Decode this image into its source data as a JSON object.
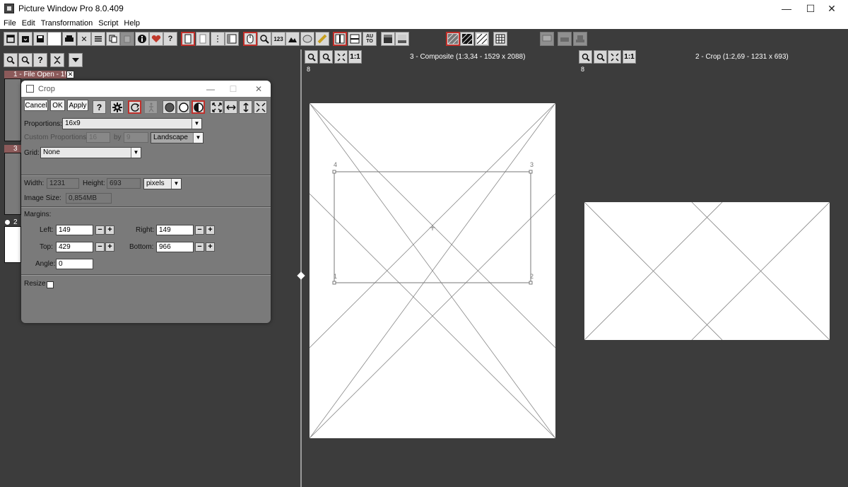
{
  "window": {
    "title": "Picture Window Pro 8.0.409",
    "minimize": "—",
    "maximize": "☐",
    "close": "✕"
  },
  "menu": [
    "File",
    "Edit",
    "Transformation",
    "Script",
    "Help"
  ],
  "toolbar": {
    "text_buttons": {
      "counter": "123",
      "auto": "AU TO",
      "ratio": "1:1"
    }
  },
  "left_panel": {
    "images": [
      {
        "index": "1",
        "label": "1 - File Open - 1!"
      },
      {
        "index": "3",
        "label": "3"
      },
      {
        "index": "2",
        "label": "2"
      }
    ]
  },
  "crop_dialog": {
    "title": "Crop",
    "buttons": {
      "cancel": "Cancel",
      "ok": "OK",
      "apply": "Apply",
      "help": "?"
    },
    "proportions_label": "Proportions:",
    "proportions_value": "16x9",
    "custom_proportions_label": "Custom Proportions:",
    "custom_w": "16",
    "by_label": "by",
    "custom_h": "9",
    "orientation": "Landscape",
    "grid_label": "Grid:",
    "grid_value": "None",
    "width_label": "Width:",
    "width_value": "1231",
    "height_label": "Height:",
    "height_value": "693",
    "units": "pixels",
    "image_size_label": "Image Size:",
    "image_size_value": "0,854MB",
    "margins_label": "Margins:",
    "left_label": "Left:",
    "left_value": "149",
    "right_label": "Right:",
    "right_value": "149",
    "top_label": "Top:",
    "top_value": "429",
    "bottom_label": "Bottom:",
    "bottom_value": "966",
    "angle_label": "Angle:",
    "angle_value": "0",
    "resize_label": "Resize"
  },
  "panes": [
    {
      "title": "3 - Composite (1:3,34 - 1529 x 2088)",
      "zoom": "8",
      "corner_labels": [
        "4",
        "3",
        "1",
        "2"
      ]
    },
    {
      "title": "2 - Crop (1:2,69 - 1231 x 693)",
      "zoom": "8"
    }
  ],
  "colors": {
    "background": "#3c3c3c",
    "dialog": "#7a7a7a",
    "accent_red": "#c0302b",
    "label_tab": "#8c5a5a"
  }
}
